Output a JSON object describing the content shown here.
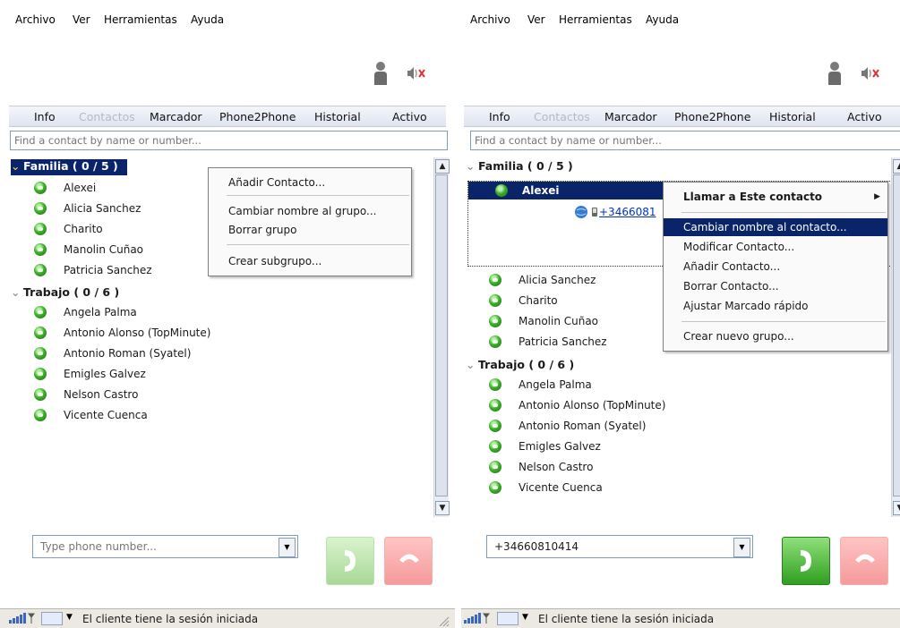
{
  "menubar": [
    "Archivo",
    "Ver",
    "Herramientas",
    "Ayuda"
  ],
  "tabs": {
    "info": "Info",
    "contactos": "Contactos",
    "marcador": "Marcador",
    "phone2phone": "Phone2Phone",
    "historial": "Historial",
    "activo": "Activo"
  },
  "search": {
    "placeholder": "Find a contact by name or number..."
  },
  "groups": {
    "familia": {
      "label": "Familia ( 0 / 5 )",
      "contacts": [
        "Alexei",
        "Alicia Sanchez",
        "Charito",
        "Manolin Cuñao",
        "Patricia Sanchez"
      ]
    },
    "trabajo": {
      "label": "Trabajo ( 0 / 6 )",
      "contacts": [
        "Angela Palma",
        "Antonio Alonso (TopMinute)",
        "Antonio Roman (Syatel)",
        "Emigles Galvez",
        "Nelson Castro",
        "Vicente Cuenca"
      ]
    }
  },
  "left_menu": {
    "items": [
      "Añadir Contacto...",
      "Cambiar nombre al grupo...",
      "Borrar grupo",
      "Crear subgrupo..."
    ]
  },
  "right_menu": {
    "items": [
      "Llamar a Este contacto",
      "Cambiar nombre al contacto...",
      "Modificar Contacto...",
      "Añadir Contacto...",
      "Borrar Contacto...",
      "Ajustar Marcado rápido",
      "Crear nuevo grupo..."
    ],
    "highlighted": "Cambiar nombre al contacto..."
  },
  "expanded_contact": {
    "name": "Alexei",
    "number_partial": "+3466081"
  },
  "left_dial": {
    "placeholder": "Type phone number..."
  },
  "right_dial": {
    "value": "+34660810414"
  },
  "status": {
    "text": "El cliente tiene la sesión iniciada"
  },
  "colors": {
    "selection": "#0a246a",
    "call_green": "#2f9f1f",
    "hangup_red": "#ee5b5b",
    "link_blue": "#0033cc"
  }
}
